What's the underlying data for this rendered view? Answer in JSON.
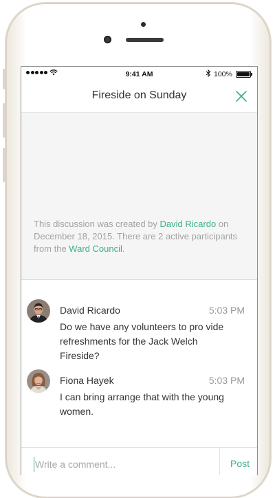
{
  "status_bar": {
    "time": "9:41 AM",
    "battery_percent": "100%",
    "icons": [
      "signal-dots-icon",
      "wifi-icon",
      "bluetooth-icon",
      "battery-icon"
    ]
  },
  "nav": {
    "title": "Fireside on Sunday",
    "close_icon": "close-icon"
  },
  "info": {
    "prefix": "This discussion was created by ",
    "creator": "David Ricardo",
    "middle": " on December 18, 2015. There are 2 active participants from the ",
    "group": "Ward Council",
    "suffix": "."
  },
  "messages": [
    {
      "author": "David Ricardo",
      "time": "5:03 PM",
      "text": "Do we have any volunteers to pro vide refreshments for the Jack Welch Fireside?"
    },
    {
      "author": "Fiona Hayek",
      "time": "5:03 PM",
      "text": "I can bring arrange that with the young women."
    }
  ],
  "composer": {
    "placeholder": "Write a comment...",
    "value": "",
    "post_label": "Post"
  },
  "colors": {
    "accent": "#3ab08a",
    "muted_text": "#a2a2a2",
    "info_background": "#f5f5f5"
  }
}
